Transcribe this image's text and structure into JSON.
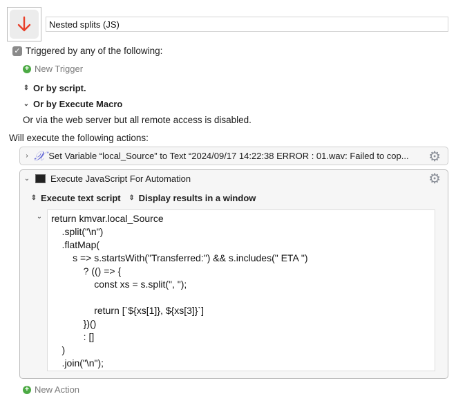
{
  "macro": {
    "icon": "down-arrow-icon",
    "icon_color": "#e8402a",
    "name": "Nested splits (JS)"
  },
  "triggers": {
    "checked": true,
    "label": "Triggered by any of the following:",
    "new_trigger": "New Trigger",
    "or_script": "Or by script.",
    "or_execute_macro": "Or by Execute Macro",
    "web_server": "Or via the web server but all remote access is disabled."
  },
  "actions_label": "Will execute the following actions:",
  "actions": [
    {
      "title": "Set Variable “local_Source” to Text “2024/09/17 14:22:38 ERROR : 01.wav: Failed to cop...",
      "expanded": false,
      "icon": "variable-x-icon"
    },
    {
      "title": "Execute JavaScript For Automation",
      "expanded": true,
      "icon": "terminal-icon",
      "option1": "Execute text script",
      "option2": "Display results in a window",
      "code": [
        "return kmvar.local_Source",
        "    .split(\"\\n\")",
        "    .flatMap(",
        "        s => s.startsWith(\"Transferred:\") && s.includes(\" ETA \")",
        "            ? (() => {",
        "                const xs = s.split(\", \");",
        "",
        "                return [`${xs[1]}, ${xs[3]}`]",
        "            })()",
        "            : []",
        "    )",
        "    .join(\"\\n\");"
      ]
    }
  ],
  "new_action": "New Action"
}
